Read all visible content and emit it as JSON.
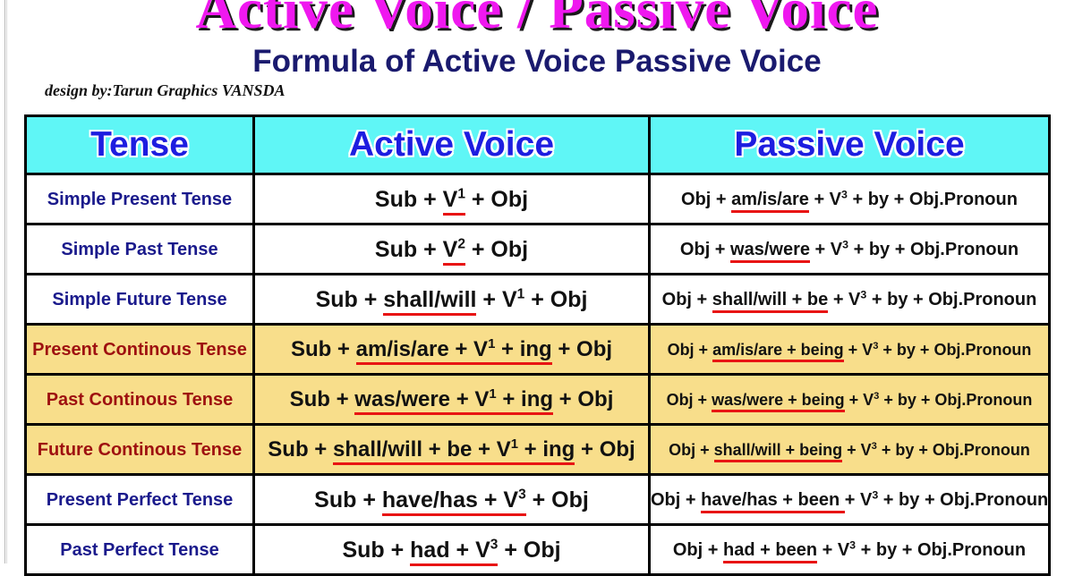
{
  "main_title": "Active Voice / Passive Voice",
  "sub_title": "Formula of Active Voice Passive Voice",
  "credit": "design by:Tarun Graphics VANSDA",
  "colors": {
    "title": "#ef18ef",
    "title_shadow": "#1a1a1a",
    "subtitle": "#1a1a6e",
    "header_bg": "#5ff6f6",
    "header_text": "#1d1de0",
    "row_white_bg": "#ffffff",
    "row_yellow_bg": "#f8de8b",
    "tense_blue": "#1a1a8c",
    "tense_red": "#9e1010",
    "underline_red": "#e81414",
    "border": "#000000"
  },
  "table": {
    "headers": {
      "tense": "Tense",
      "active": "Active Voice",
      "passive": "Passive Voice"
    },
    "rows": [
      {
        "tense": "Simple Present Tense",
        "highlight": "white",
        "active": "Sub  +  V¹  +  Obj",
        "active_parts": [
          {
            "t": "Sub  +  ",
            "u": false
          },
          {
            "t": "V¹",
            "u": true,
            "sup": "1"
          },
          {
            "t": "  +  Obj",
            "u": false
          }
        ],
        "passive": "Obj + am/is/are + V³ + by + Obj.Pronoun",
        "passive_parts": [
          {
            "t": "Obj + ",
            "u": false
          },
          {
            "t": "am/is/are",
            "u": true
          },
          {
            "t": " + V³ + by + Obj.Pronoun",
            "u": false
          }
        ]
      },
      {
        "tense": "Simple Past Tense",
        "highlight": "white",
        "active": "Sub + V² + Obj",
        "passive": "Obj + was/were + V³ + by + Obj.Pronoun"
      },
      {
        "tense": "Simple Future Tense",
        "highlight": "white",
        "active": "Sub + shall/will + V¹ + Obj",
        "passive": "Obj + shall/will + be + V³ + by + Obj.Pronoun"
      },
      {
        "tense": "Present Continous Tense",
        "highlight": "yellow",
        "active": "Sub + am/is/are + V¹ + ing + Obj",
        "passive": "Obj + am/is/are + being + V³ + by + Obj.Pronoun"
      },
      {
        "tense": "Past Continous Tense",
        "highlight": "yellow",
        "active": "Sub + was/were + V¹ + ing + Obj",
        "passive": "Obj + was/were + being + V³ + by + Obj.Pronoun"
      },
      {
        "tense": "Future Continous Tense",
        "highlight": "yellow",
        "active": "Sub + shall/will + be + V¹ + ing + Obj",
        "passive": "Obj + shall/will + being + V³ + by + Obj.Pronoun"
      },
      {
        "tense": "Present Perfect Tense",
        "highlight": "white",
        "active": "Sub + have/has + V³ + Obj",
        "passive": "Obj + have/has + been + V³ + by + Obj.Pronoun"
      },
      {
        "tense": "Past Perfect Tense",
        "highlight": "white",
        "active": "Sub + had + V³ + Obj",
        "passive": "Obj + had + been + V³ + by + Obj.Pronoun"
      }
    ]
  },
  "underlines": {
    "r0_active": "V¹",
    "r0_passive": "am/is/are",
    "r1_active": "V²",
    "r1_passive": "was/were",
    "r2_active": "shall/will",
    "r2_passive": "shall/will + be",
    "r3_active": "am/is/are + V¹ + ing",
    "r3_passive": "am/is/are + being",
    "r4_active": "was/were + V¹ + ing",
    "r4_passive": "was/were + being",
    "r5_active": "shall/will + be + V¹ + ing",
    "r5_passive": "shall/will + being",
    "r6_active": "have/has + V³",
    "r6_passive": "have/has + been ",
    "r7_active": "had + V³",
    "r7_passive": "had + been"
  }
}
